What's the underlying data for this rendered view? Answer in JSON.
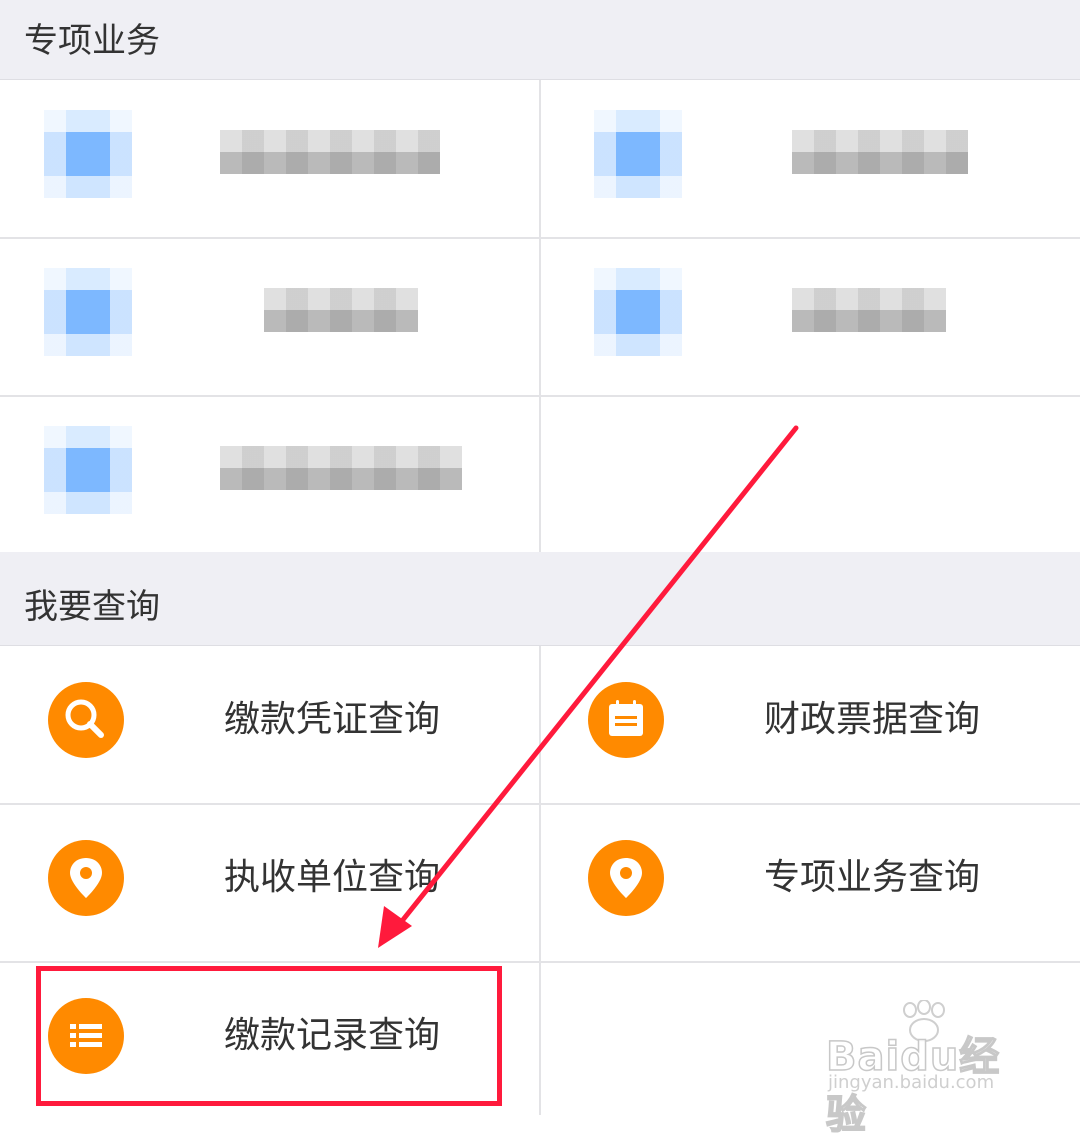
{
  "sections": {
    "special": {
      "title": "专项业务"
    },
    "query": {
      "title": "我要查询",
      "items": [
        {
          "label": "缴款凭证查询",
          "icon": "search-icon"
        },
        {
          "label": "财政票据查询",
          "icon": "notepad-icon"
        },
        {
          "label": "执收单位查询",
          "icon": "location-pin-icon"
        },
        {
          "label": "专项业务查询",
          "icon": "location-pin-icon"
        },
        {
          "label": "缴款记录查询",
          "icon": "list-icon"
        }
      ]
    }
  },
  "watermark": {
    "brand": "Baidu经验",
    "url": "jingyan.baidu.com"
  },
  "colors": {
    "icon_orange": "#ff8a00",
    "highlight_red": "#ff1a3c",
    "section_bg": "#efeff4"
  }
}
